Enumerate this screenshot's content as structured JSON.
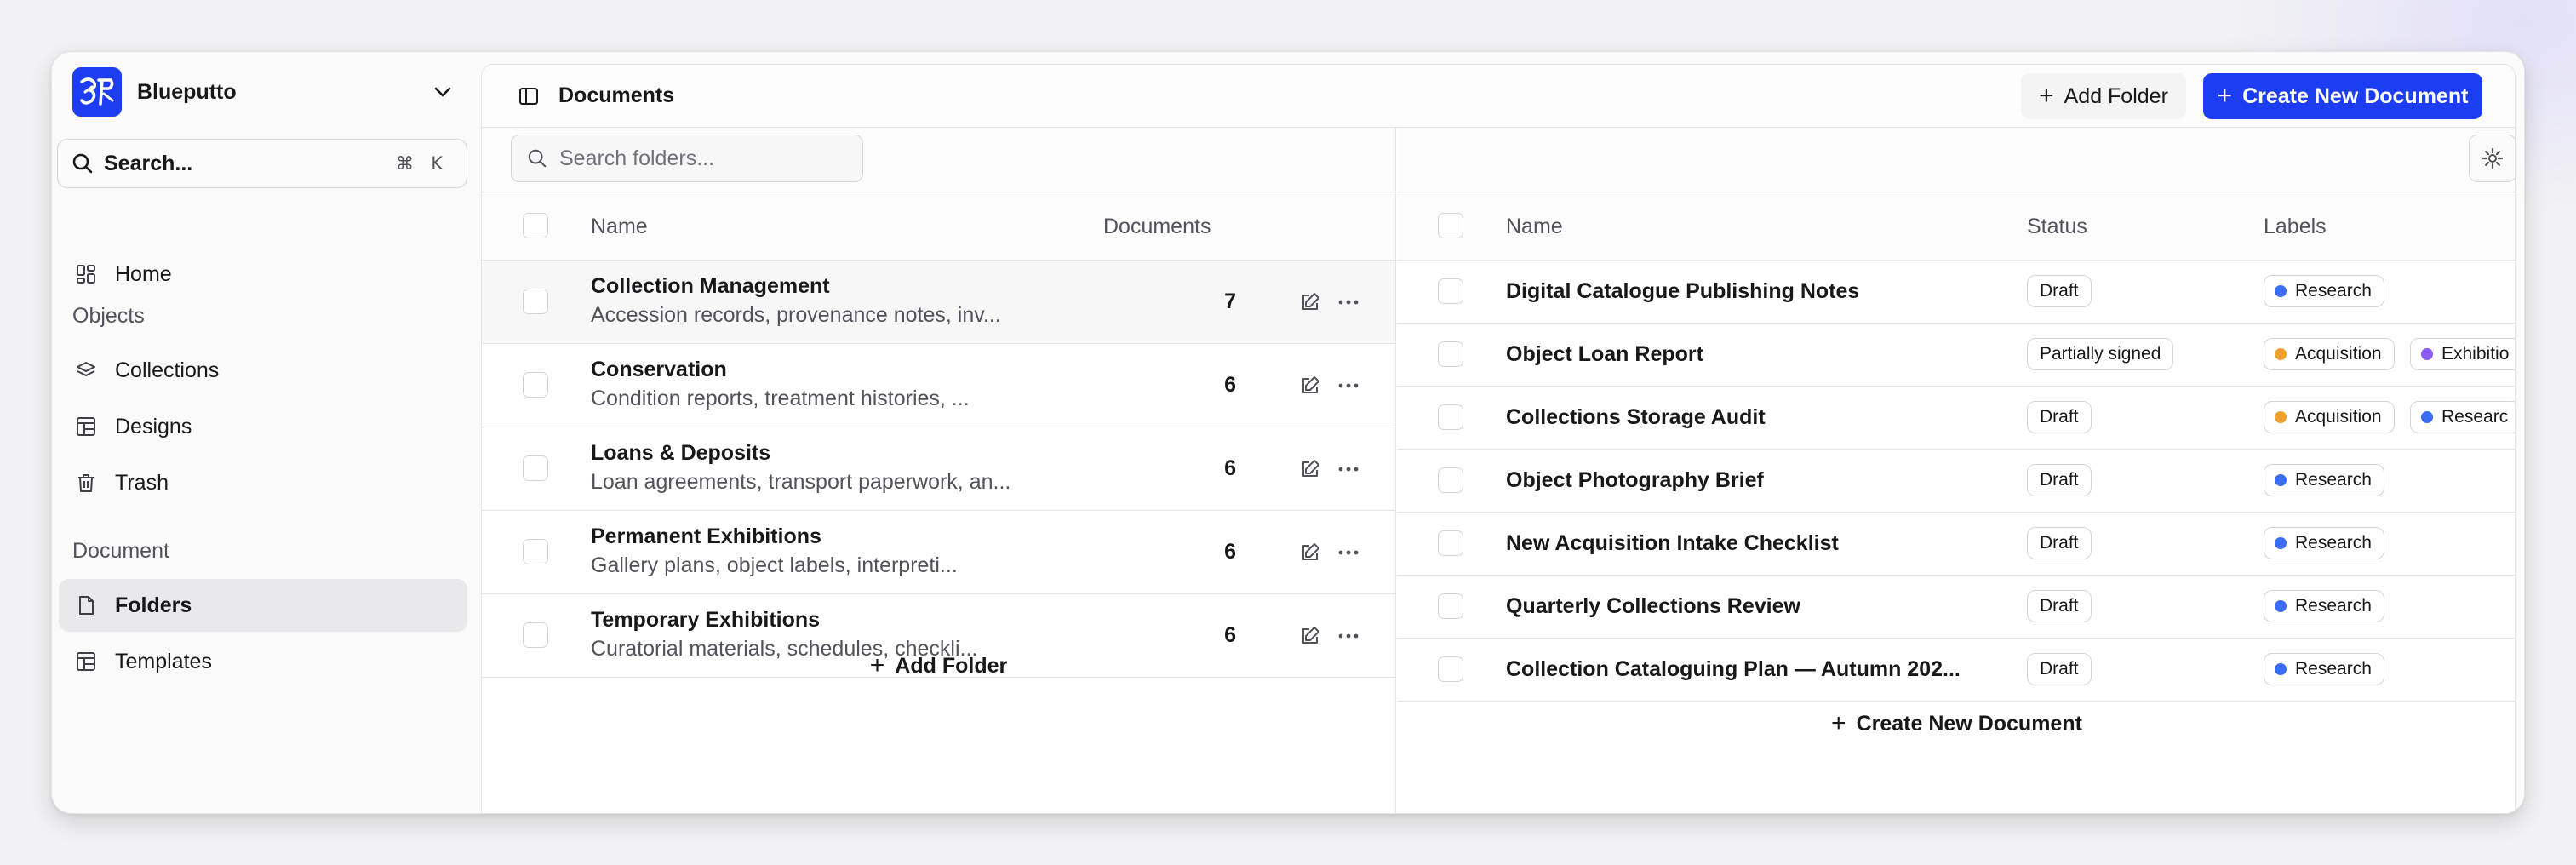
{
  "app": {
    "name": "Blueputto",
    "brand_color": "#1d3df5"
  },
  "sidebar": {
    "search_label": "Search...",
    "search_shortcut_mod": "⌘",
    "search_shortcut_key": "K",
    "home": "Home",
    "objects_heading": "Objects",
    "objects": [
      "Collections",
      "Designs",
      "Trash"
    ],
    "document_heading": "Document",
    "document_items": [
      "Folders",
      "Templates"
    ],
    "active_item": "Folders"
  },
  "header": {
    "title": "Documents",
    "add_folder": "Add Folder",
    "create_document": "Create New Document"
  },
  "folders": {
    "search_placeholder": "Search folders...",
    "columns": {
      "name": "Name",
      "documents": "Documents"
    },
    "rows": [
      {
        "name": "Collection Management",
        "description": "Accession records, provenance notes, inv...",
        "count": "7"
      },
      {
        "name": "Conservation",
        "description": "Condition reports, treatment histories, ...",
        "count": "6"
      },
      {
        "name": "Loans & Deposits",
        "description": "Loan agreements, transport paperwork, an...",
        "count": "6"
      },
      {
        "name": "Permanent Exhibitions",
        "description": "Gallery plans, object labels, interpreti...",
        "count": "6"
      },
      {
        "name": "Temporary Exhibitions",
        "description": "Curatorial materials, schedules, checkli...",
        "count": "6"
      }
    ],
    "add_folder": "Add Folder"
  },
  "documents": {
    "columns": {
      "name": "Name",
      "status": "Status",
      "labels": "Labels"
    },
    "label_colors": {
      "Research": "#3b6cf6",
      "Acquisition": "#f0a030",
      "Exhibition": "#8b5cf6"
    },
    "rows": [
      {
        "name": "Digital Catalogue Publishing Notes",
        "status": "Draft",
        "labels": [
          "Research"
        ]
      },
      {
        "name": "Object Loan Report",
        "status": "Partially signed",
        "labels": [
          "Acquisition",
          "Exhibitio"
        ]
      },
      {
        "name": "Collections Storage Audit",
        "status": "Draft",
        "labels": [
          "Acquisition",
          "Researc"
        ]
      },
      {
        "name": "Object Photography Brief",
        "status": "Draft",
        "labels": [
          "Research"
        ]
      },
      {
        "name": "New Acquisition Intake Checklist",
        "status": "Draft",
        "labels": [
          "Research"
        ]
      },
      {
        "name": "Quarterly Collections Review",
        "status": "Draft",
        "labels": [
          "Research"
        ]
      },
      {
        "name": "Collection Cataloguing Plan — Autumn 202...",
        "status": "Draft",
        "labels": [
          "Research"
        ]
      }
    ],
    "create_document": "Create New Document"
  }
}
